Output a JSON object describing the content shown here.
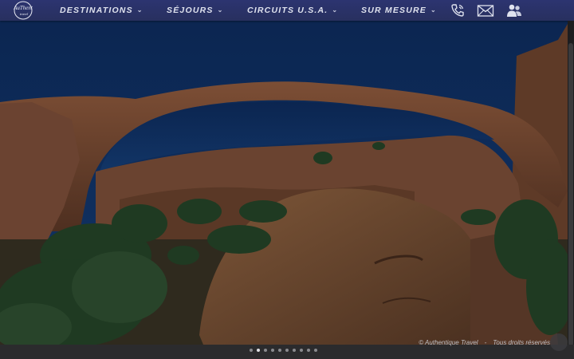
{
  "nav": {
    "logo_label": "AuThentic Travel",
    "menu": [
      {
        "label": "DESTINATIONS"
      },
      {
        "label": "SÉJOURS"
      },
      {
        "label": "CIRCUITS U.S.A."
      },
      {
        "label": "SUR MESURE"
      }
    ],
    "icons": [
      "phone-icon",
      "mail-icon",
      "users-icon"
    ]
  },
  "hero": {
    "slide_count": 10,
    "active_slide": 2
  },
  "credit": {
    "copyright": "© Authentique Travel",
    "separator": "-",
    "rights": "Tous droits réservés"
  },
  "colors": {
    "nav_bg": "#2c3470",
    "sky": "#0e2a55",
    "rock": "#7a4b32"
  }
}
